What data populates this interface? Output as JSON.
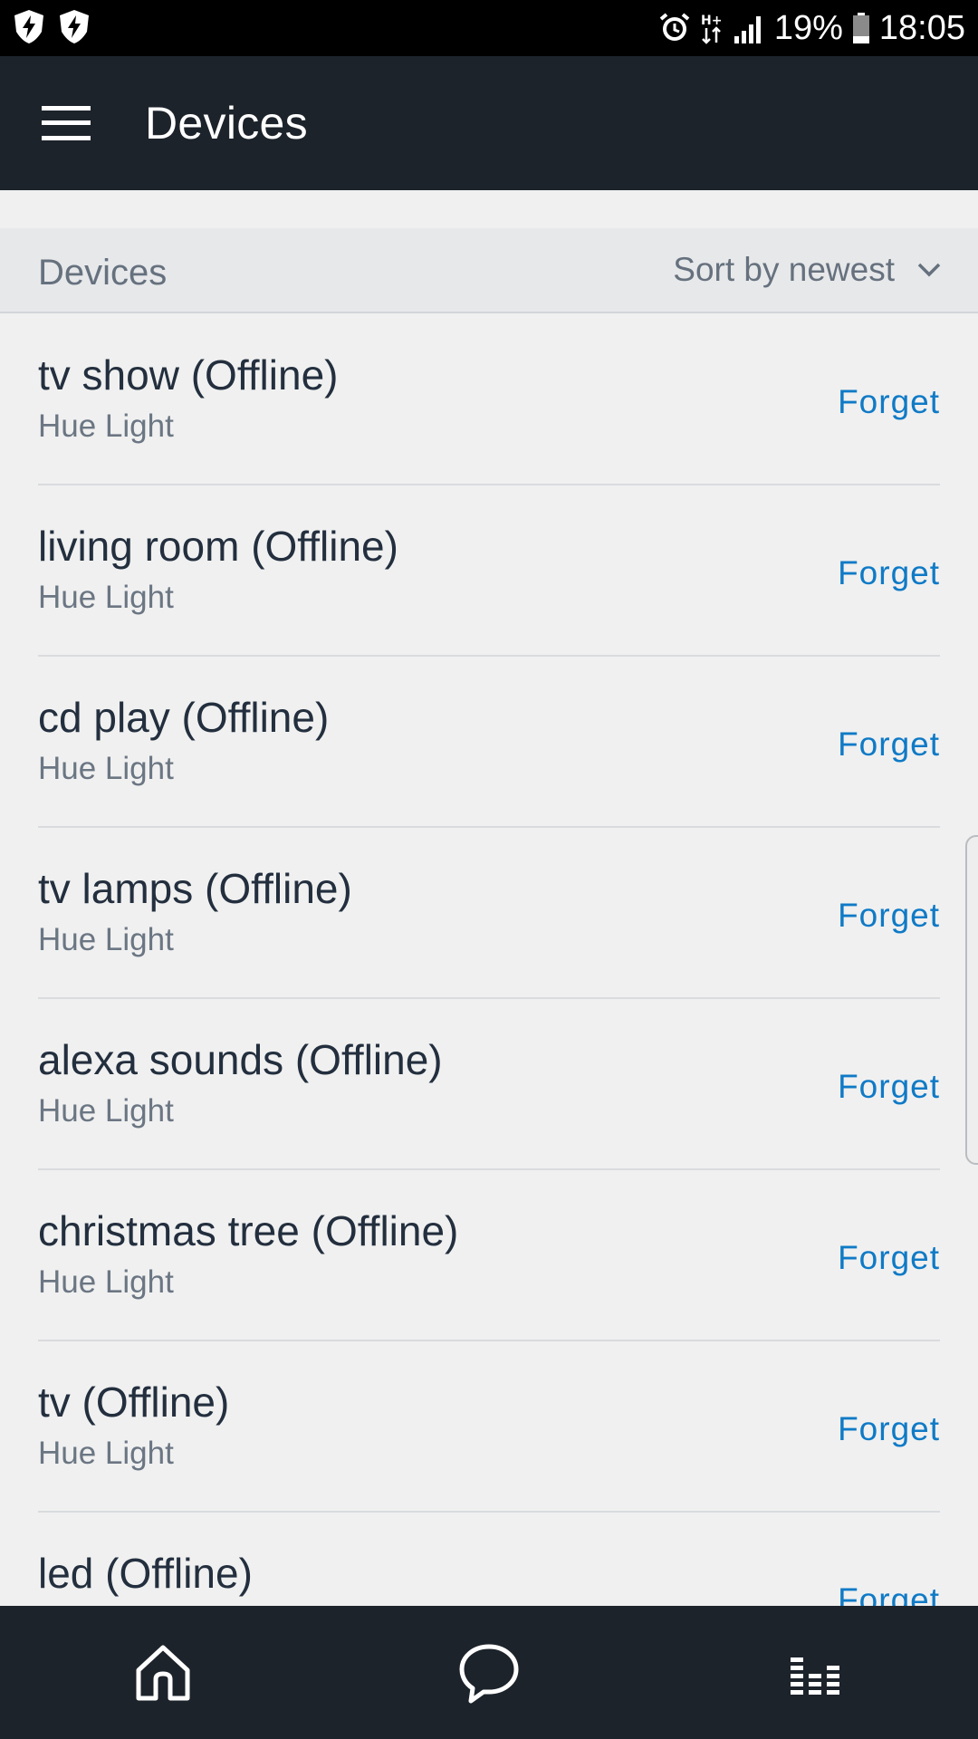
{
  "status_bar": {
    "left_icons": [
      "shield-bolt-icon",
      "shield-bolt-icon"
    ],
    "battery_percent": "19%",
    "time": "18:05",
    "icons": [
      "alarm-icon",
      "data-arrows-icon",
      "signal-icon",
      "battery-icon"
    ]
  },
  "app_bar": {
    "title": "Devices",
    "menu_icon": "hamburger-menu-icon"
  },
  "section": {
    "title": "Devices",
    "sort_label": "Sort by newest",
    "sort_icon": "chevron-down-icon"
  },
  "devices": [
    {
      "name": "tv show (Offline)",
      "type": "Hue Light",
      "action": "Forget"
    },
    {
      "name": "living room (Offline)",
      "type": "Hue Light",
      "action": "Forget"
    },
    {
      "name": "cd play (Offline)",
      "type": "Hue Light",
      "action": "Forget"
    },
    {
      "name": "tv lamps (Offline)",
      "type": "Hue Light",
      "action": "Forget"
    },
    {
      "name": "alexa sounds (Offline)",
      "type": "Hue Light",
      "action": "Forget"
    },
    {
      "name": "christmas tree (Offline)",
      "type": "Hue Light",
      "action": "Forget"
    },
    {
      "name": "tv (Offline)",
      "type": "Hue Light",
      "action": "Forget"
    },
    {
      "name": "led (Offline)",
      "type": "",
      "action": "Forget"
    }
  ],
  "bottom_nav": [
    {
      "icon": "home-icon"
    },
    {
      "icon": "chat-bubble-icon"
    },
    {
      "icon": "equalizer-icon"
    }
  ],
  "colors": {
    "status_bar_bg": "#000000",
    "app_bar_bg": "#1d232b",
    "page_bg": "#f0f0f0",
    "header_bg": "#e7e8ea",
    "link_blue": "#0f7ac6",
    "primary_text": "#232f3e",
    "secondary_text": "#6b7683"
  }
}
